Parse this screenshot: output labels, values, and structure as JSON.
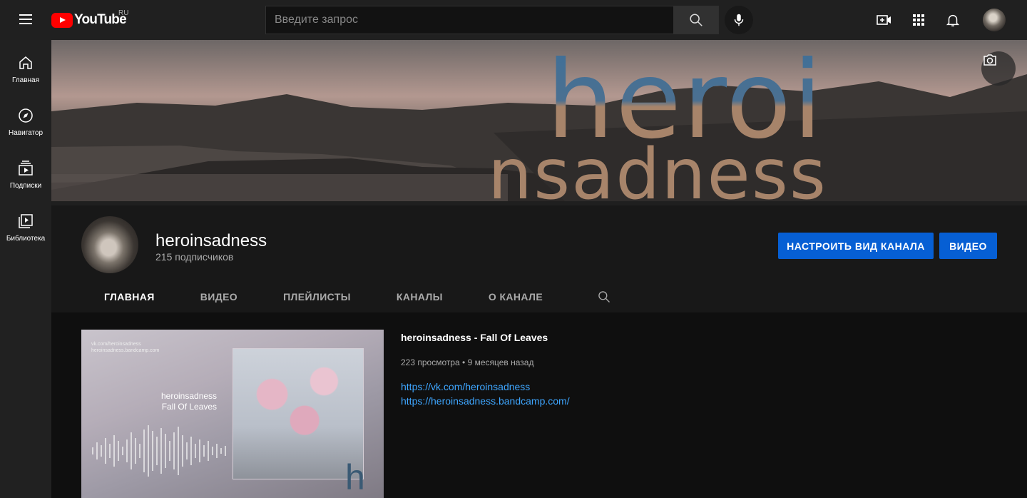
{
  "topbar": {
    "logo_text": "YouTube",
    "region": "RU",
    "search_placeholder": "Введите запрос"
  },
  "sidebar": {
    "items": [
      {
        "label": "Главная",
        "icon": "home-icon"
      },
      {
        "label": "Навигатор",
        "icon": "compass-icon"
      },
      {
        "label": "Подписки",
        "icon": "subscriptions-icon"
      },
      {
        "label": "Библиотека",
        "icon": "library-icon"
      }
    ]
  },
  "banner": {
    "line1": "heroi",
    "line2": "nsadness"
  },
  "channel": {
    "name": "heroinsadness",
    "subscribers": "215 подписчиков",
    "customize_label": "НАСТРОИТЬ ВИД КАНАЛА",
    "video_label": "ВИДЕО"
  },
  "tabs": [
    {
      "label": "ГЛАВНАЯ",
      "active": true
    },
    {
      "label": "ВИДЕО",
      "active": false
    },
    {
      "label": "ПЛЕЙЛИСТЫ",
      "active": false
    },
    {
      "label": "КАНАЛЫ",
      "active": false
    },
    {
      "label": "О КАНАЛЕ",
      "active": false
    }
  ],
  "featured_video": {
    "thumb_small_line1": "vk.com/heroinsadness",
    "thumb_small_line2": "heroinsadness.bandcamp.com",
    "thumb_title_line1": "heroinsadness",
    "thumb_title_line2": "Fall Of Leaves",
    "title": "heroinsadness - Fall Of Leaves",
    "meta": "223 просмотра • 9 месяцев назад",
    "link1": "https://vk.com/heroinsadness",
    "link2": "https://heroinsadness.bandcamp.com/"
  },
  "colors": {
    "accent_blue": "#065fd4",
    "link": "#3ea6ff",
    "brand_red": "#ff0000"
  }
}
